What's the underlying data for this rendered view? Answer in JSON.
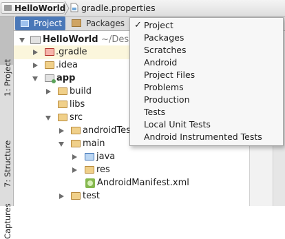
{
  "breadcrumb": {
    "project": "HelloWorld",
    "file": "gradle.properties"
  },
  "side_tabs": {
    "project": "1: Project",
    "structure": "7: Structure",
    "captures": "Captures"
  },
  "pane_tabs": {
    "project": "Project",
    "packages": "Packages"
  },
  "tree": {
    "root_name": "HelloWorld",
    "root_path": "~/Desk",
    "items": [
      {
        "label": ".gradle"
      },
      {
        "label": ".idea"
      },
      {
        "label": "app"
      },
      {
        "label": "build"
      },
      {
        "label": "libs"
      },
      {
        "label": "src"
      },
      {
        "label": "androidTes"
      },
      {
        "label": "main"
      },
      {
        "label": "java"
      },
      {
        "label": "res"
      },
      {
        "label": "AndroidManifest.xml"
      },
      {
        "label": "test"
      }
    ]
  },
  "view_menu": {
    "selected": "Project",
    "check_glyph": "✓",
    "items": [
      "Project",
      "Packages",
      "Scratches",
      "Android",
      "Project Files",
      "Problems",
      "Production",
      "Tests",
      "Local Unit Tests",
      "Android Instrumented Tests"
    ]
  },
  "colors": {
    "selected_tab": "#4a78b8",
    "selected_row": "#fbf6dc",
    "folder": "#f0d08a",
    "excluded_folder": "#f5b4aa",
    "source_folder": "#bcd7f3"
  }
}
